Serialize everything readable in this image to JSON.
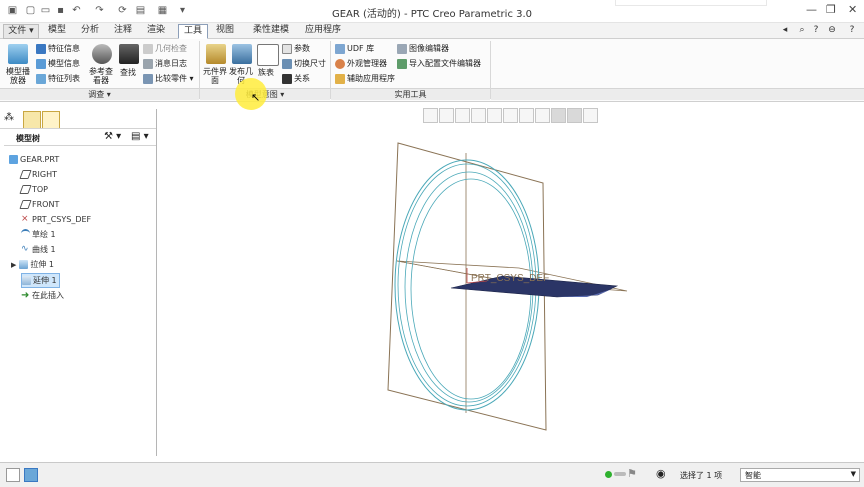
{
  "window": {
    "title": "GEAR (活动的) - PTC Creo Parametric 3.0"
  },
  "tabs": [
    {
      "label": "文件",
      "kind": "file"
    },
    {
      "label": "模型"
    },
    {
      "label": "分析"
    },
    {
      "label": "注释"
    },
    {
      "label": "渲染"
    },
    {
      "label": "工具",
      "active": true
    },
    {
      "label": "视图"
    },
    {
      "label": "柔性建模"
    },
    {
      "label": "应用程序"
    }
  ],
  "ribbon": {
    "groups": [
      {
        "label": "调查",
        "dropdown": true
      },
      {
        "label": "模型意图",
        "dropdown": true
      },
      {
        "label": "实用工具",
        "dropdown": false
      }
    ],
    "investigate": {
      "model_player": "模型播放器",
      "feature_info": "特征信息",
      "model_info": "模型信息",
      "feature_list": "特征列表",
      "reference_viewer": "参考查看器",
      "find": "查找",
      "geometry_check": "几何检查",
      "message_log": "消息日志",
      "compare_parts": "比较零件"
    },
    "intent": {
      "family_table": "族表",
      "publish_geometry": "发布几何",
      "component_interface": "元件界面",
      "table": "族表",
      "parameters": "参数",
      "switch_dimensions": "切换尺寸",
      "relations": "关系"
    },
    "utilities": {
      "udf_library": "UDF 库",
      "appearance_manager": "外观管理器",
      "auxiliary_app": "辅助应用程序",
      "image_editor": "图像编辑器",
      "import_config_editor": "导入配置文件编辑器"
    }
  },
  "model_tree": {
    "header": "模型树",
    "items": [
      {
        "label": "GEAR.PRT",
        "icon": "part-icon",
        "indent": 0
      },
      {
        "label": "RIGHT",
        "icon": "datum-plane-icon",
        "indent": 1
      },
      {
        "label": "TOP",
        "icon": "datum-plane-icon",
        "indent": 1
      },
      {
        "label": "FRONT",
        "icon": "datum-plane-icon",
        "indent": 1
      },
      {
        "label": "PRT_CSYS_DEF",
        "icon": "csys-icon",
        "indent": 1
      },
      {
        "label": "草绘 1",
        "icon": "sketch-icon",
        "indent": 1
      },
      {
        "label": "曲线 1",
        "icon": "curve-icon",
        "indent": 1
      },
      {
        "label": "拉伸 1",
        "icon": "extrude-icon",
        "indent": 1,
        "expandable": true
      },
      {
        "label": "延伸 1",
        "icon": "extend-icon",
        "indent": 1,
        "selected": true
      },
      {
        "label": "在此插入",
        "icon": "insert-here-icon",
        "indent": 1
      }
    ]
  },
  "graphics": {
    "csys_label": "PRT_CSYS_DEF"
  },
  "status": {
    "selection": "选择了 1 项",
    "filter": "智能"
  },
  "colors": {
    "accent": "#3a78c2",
    "circle": "#4aa8b8",
    "plane": "#8a7355",
    "surface": "#2b3566"
  }
}
